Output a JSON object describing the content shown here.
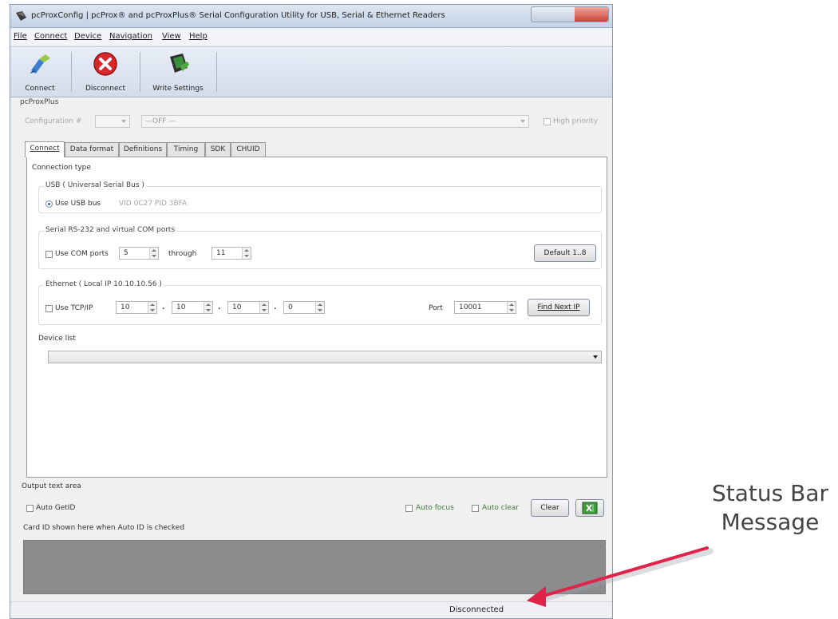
{
  "window": {
    "title": "pcProxConfig | pcProx® and pcProxPlus® Serial Configuration Utility for USB, Serial & Ethernet Readers"
  },
  "menu": [
    "File",
    "Connect",
    "Device",
    "Navigation",
    "View",
    "Help"
  ],
  "toolbar": {
    "connect_label": "Connect",
    "disconnect_label": "Disconnect",
    "write_settings_label": "Write Settings"
  },
  "device": {
    "name": "pcProxPlus",
    "config_label": "Configuration #",
    "config_value": "—OFF —",
    "high_priority_label": "High priority"
  },
  "tabs": [
    "Connect",
    "Data format",
    "Definitions",
    "Timing",
    "SDK",
    "CHUID"
  ],
  "connect": {
    "connection_type_label": "Connection type",
    "usb": {
      "title": "USB ( Universal Serial Bus )",
      "option_label": "Use USB bus",
      "ids": "VID 0C27 PID 3BFA"
    },
    "serial": {
      "title": "Serial RS-232 and virtual COM ports",
      "option_label": "Use COM ports",
      "from_value": "5",
      "through_label": "through",
      "to_value": "11",
      "default_button": "Default 1..8"
    },
    "ethernet": {
      "title": "Ethernet ( Local IP 10.10.10.56 )",
      "option_label": "Use TCP/IP",
      "ip": [
        "10",
        "10",
        "10",
        "0"
      ],
      "port_label": "Port",
      "port_value": "10001",
      "find_button": "Find Next IP"
    },
    "device_list_label": "Device list"
  },
  "output": {
    "title": "Output text area",
    "auto_getid_label": "Auto GetID",
    "auto_focus_label": "Auto focus",
    "auto_clear_label": "Auto clear",
    "clear_button": "Clear",
    "hint": "Card ID shown here when Auto ID is checked"
  },
  "status": {
    "message": "Disconnected"
  },
  "annotation": {
    "line1": "Status Bar",
    "line2": "Message"
  },
  "colors": {
    "accent_arrow": "#e0234a",
    "output_area": "#8c8c8c"
  }
}
